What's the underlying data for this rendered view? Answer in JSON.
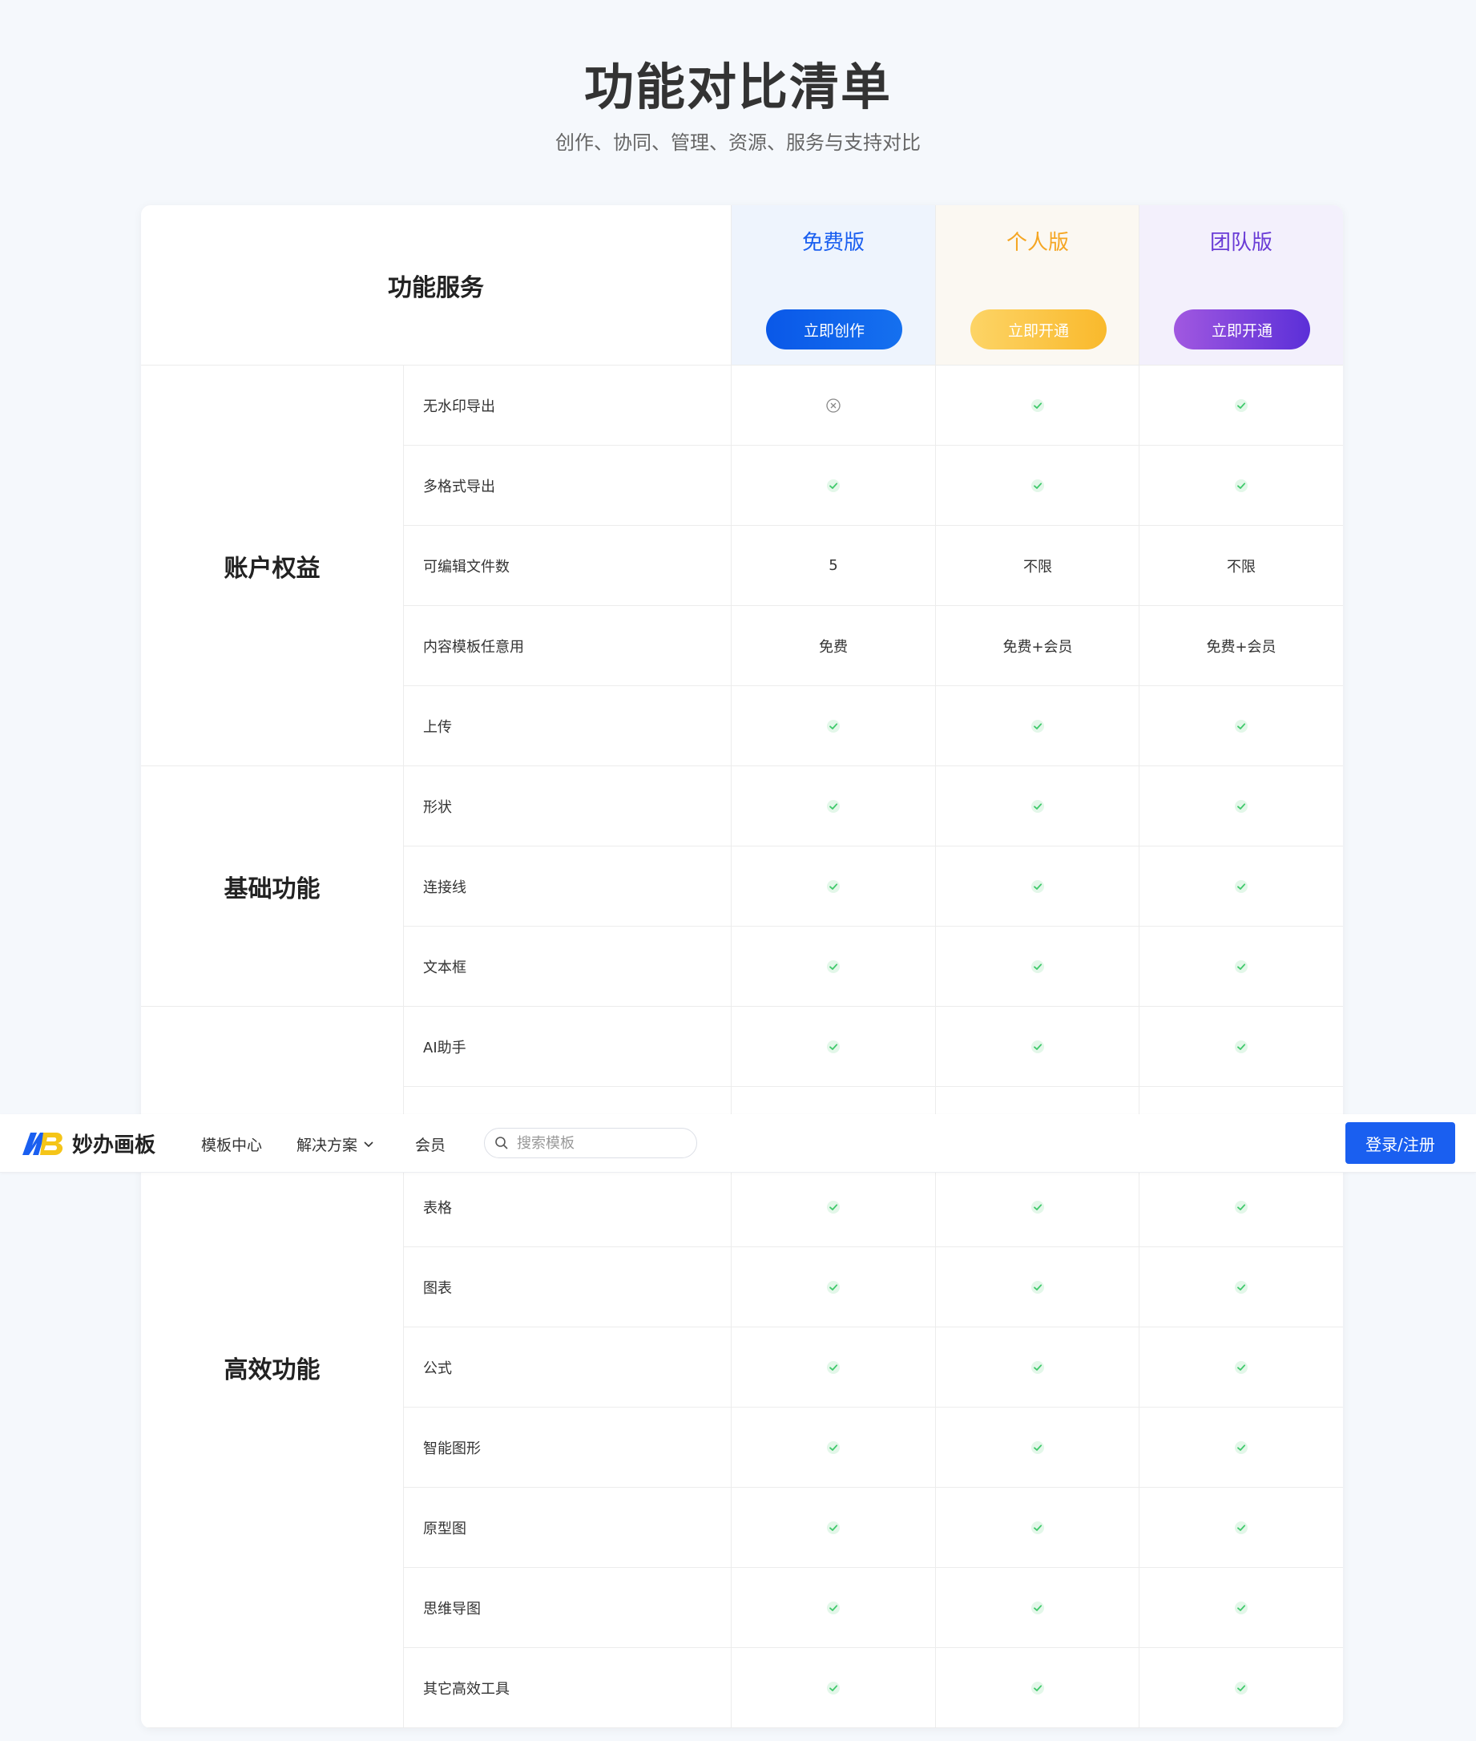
{
  "page": {
    "title": "功能对比清单",
    "subtitle": "创作、协同、管理、资源、服务与支持对比"
  },
  "table": {
    "header_label": "功能服务",
    "plans": [
      {
        "name": "免费版",
        "button": "立即创作",
        "name_color": "#1a5ff0",
        "bg": "#eef4fd",
        "button_bg": "linear-gradient(90deg,#0a58e8,#1570ef)"
      },
      {
        "name": "个人版",
        "button": "立即开通",
        "name_color": "#f5a623",
        "bg": "#fbf8f2",
        "button_bg": "linear-gradient(90deg,#fdd466,#f9b92c)"
      },
      {
        "name": "团队版",
        "button": "立即开通",
        "name_color": "#6a3cd6",
        "bg": "#f3f0fc",
        "button_bg": "linear-gradient(90deg,#a158e0,#5b2fd8)"
      }
    ],
    "groups": [
      {
        "name": "账户权益",
        "rows": [
          {
            "feature": "无水印导出",
            "values": [
              "cross",
              "check",
              "check"
            ]
          },
          {
            "feature": "多格式导出",
            "values": [
              "check",
              "check",
              "check"
            ]
          },
          {
            "feature": "可编辑文件数",
            "values": [
              "5",
              "不限",
              "不限"
            ]
          },
          {
            "feature": "内容模板任意用",
            "values": [
              "免费",
              "免费+会员",
              "免费+会员"
            ]
          },
          {
            "feature": "上传",
            "values": [
              "check",
              "check",
              "check"
            ]
          }
        ]
      },
      {
        "name": "基础功能",
        "rows": [
          {
            "feature": "形状",
            "values": [
              "check",
              "check",
              "check"
            ]
          },
          {
            "feature": "连接线",
            "values": [
              "check",
              "check",
              "check"
            ]
          },
          {
            "feature": "文本框",
            "values": [
              "check",
              "check",
              "check"
            ]
          }
        ]
      },
      {
        "name": "高效功能",
        "rows": [
          {
            "feature": "AI助手",
            "values": [
              "check",
              "check",
              "check"
            ]
          },
          {
            "feature": "",
            "values": [
              "",
              "",
              ""
            ]
          },
          {
            "feature": "表格",
            "values": [
              "check",
              "check",
              "check"
            ]
          },
          {
            "feature": "图表",
            "values": [
              "check",
              "check",
              "check"
            ]
          },
          {
            "feature": "公式",
            "values": [
              "check",
              "check",
              "check"
            ]
          },
          {
            "feature": "智能图形",
            "values": [
              "check",
              "check",
              "check"
            ]
          },
          {
            "feature": "原型图",
            "values": [
              "check",
              "check",
              "check"
            ]
          },
          {
            "feature": "思维导图",
            "values": [
              "check",
              "check",
              "check"
            ]
          },
          {
            "feature": "其它高效工具",
            "values": [
              "check",
              "check",
              "check"
            ]
          }
        ]
      }
    ]
  },
  "navbar": {
    "logo_text": "妙办画板",
    "items": [
      {
        "label": "模板中心"
      },
      {
        "label": "解决方案"
      },
      {
        "label": "会员"
      }
    ],
    "search_placeholder": "搜索模板",
    "login_label": "登录/注册"
  },
  "colors": {
    "check": "#3fc96b",
    "check_bg": "#e3f7e9",
    "cross": "#888888",
    "accent": "#1a5ff0"
  }
}
